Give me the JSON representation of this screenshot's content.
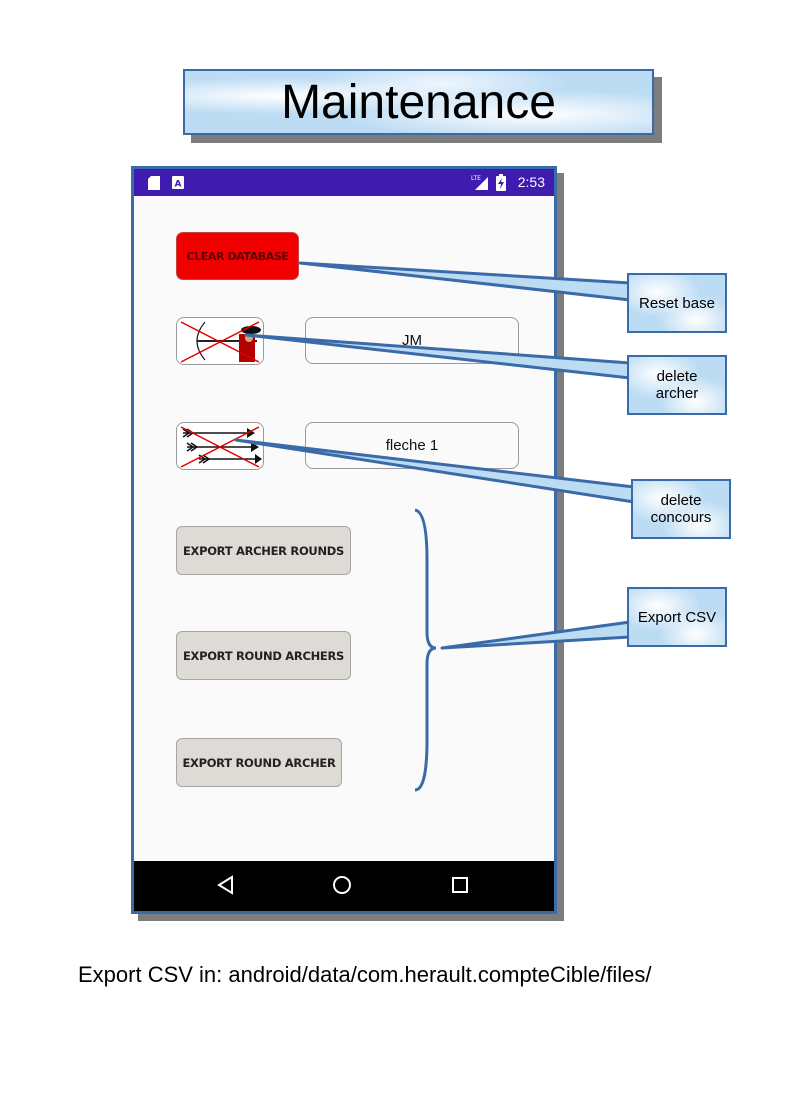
{
  "title": "Maintenance",
  "status_bar": {
    "time": "2:53"
  },
  "buttons": {
    "clear_database": "CLEAR DATABASE",
    "export_archer_rounds": "EXPORT ARCHER ROUNDS",
    "export_round_archers": "EXPORT ROUND ARCHERS",
    "export_round_archer": "EXPORT ROUND ARCHER"
  },
  "fields": {
    "archer": "JM",
    "concours": "fleche 1"
  },
  "callouts": {
    "reset_base": "Reset base",
    "delete_archer_line1": "delete",
    "delete_archer_line2": "archer",
    "delete_concours_line1": "delete",
    "delete_concours_line2": "concours",
    "export_csv": "Export CSV"
  },
  "footer": "Export CSV in: android/data/com.herault.compteCible/files/",
  "colors": {
    "status_bar": "#3f1bb0",
    "clear_button": "#f20000",
    "callout_border": "#3a6aa8",
    "callout_fill": "#bcdcf4"
  },
  "icons": [
    "sd-card-icon",
    "a-notification-icon",
    "lte-signal-icon",
    "battery-charging-icon",
    "back-icon",
    "home-icon",
    "recents-icon",
    "delete-archer-icon",
    "delete-concours-icon"
  ]
}
